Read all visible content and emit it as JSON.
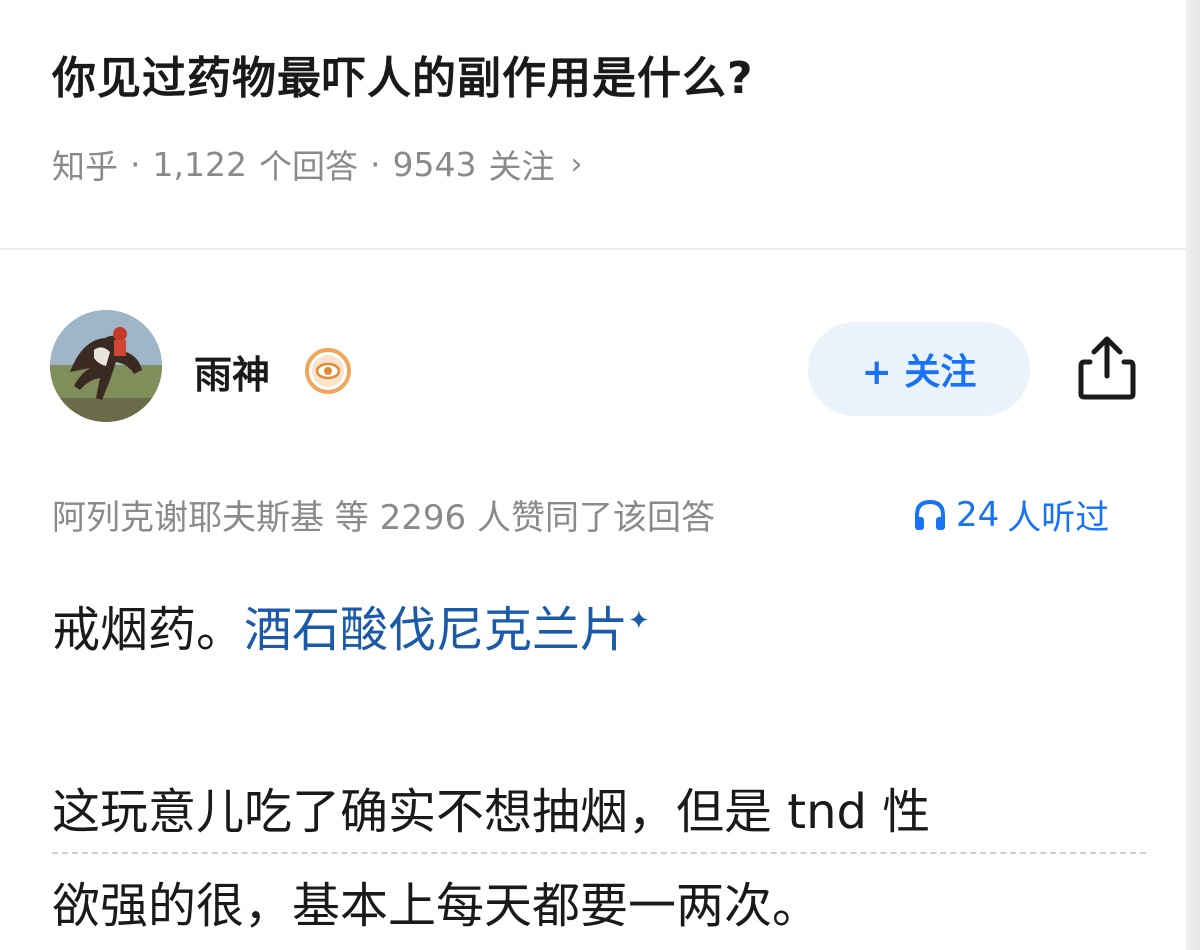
{
  "question": {
    "title": "你见过药物最吓人的副作用是什么?",
    "source": "知乎",
    "answers_count": "1,122",
    "answers_label": "个回答",
    "followers_count": "9543",
    "followers_label": "关注",
    "separator": "·",
    "chevron": "›"
  },
  "author": {
    "name": "雨神",
    "badge_icon": "eye-badge-icon",
    "follow_label": "+ 关注",
    "share_icon": "share-icon"
  },
  "approval": {
    "text": "阿列克谢耶夫斯基 等 2296 人赞同了该回答",
    "listen_count": "24",
    "listen_label": "人听过"
  },
  "answer": {
    "line1_prefix": "戒烟药。",
    "line1_link": "酒石酸伐尼克兰片",
    "link_icon": "✦",
    "para2_line1": "这玩意儿吃了确实不想抽烟，但是 tnd 性",
    "para2_line2": "欲强的很，基本上每天都要一两次。"
  },
  "colors": {
    "link_blue": "#1772f6",
    "answer_link": "#1a5aa8",
    "follow_bg": "#eaf2fc",
    "badge_orange": "#f0a65a",
    "meta_gray": "#8a8a8a"
  }
}
